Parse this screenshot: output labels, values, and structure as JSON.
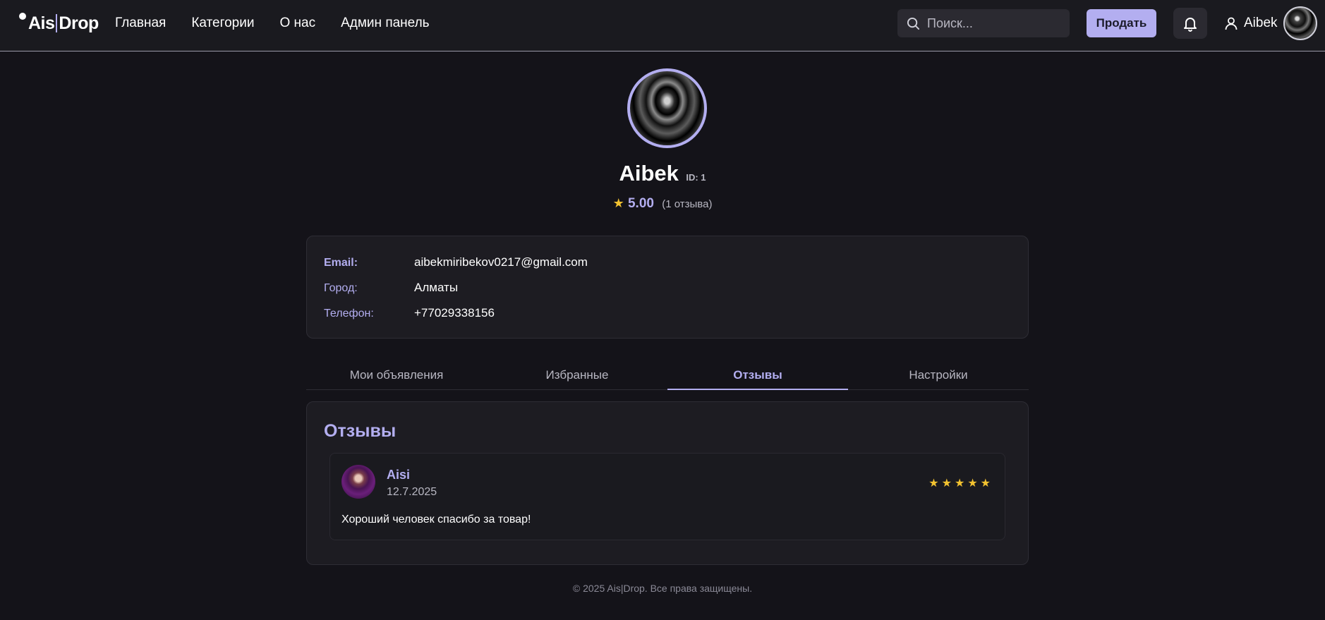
{
  "header": {
    "logo_left": "Ais",
    "logo_right": "Drop",
    "nav": [
      "Главная",
      "Категории",
      "О нас",
      "Админ панель"
    ],
    "search_placeholder": "Поиск...",
    "sell_label": "Продать",
    "username": "Aibek"
  },
  "profile": {
    "name": "Aibek",
    "id_label": "ID: 1",
    "rating_value": "5.00",
    "rating_count": "(1 отзыва)"
  },
  "info": {
    "rows": [
      {
        "label": "Email:",
        "value": "aibekmiribekov0217@gmail.com"
      },
      {
        "label": "Город:",
        "value": "Алматы"
      },
      {
        "label": "Телефон:",
        "value": "+77029338156"
      }
    ]
  },
  "tabs": [
    "Мои объявления",
    "Избранные",
    "Отзывы",
    "Настройки"
  ],
  "active_tab": 2,
  "reviews": {
    "title": "Отзывы",
    "items": [
      {
        "author": "Aisi",
        "date": "12.7.2025",
        "stars": 5,
        "text": "Хороший человек спасибо за товар!"
      }
    ]
  },
  "footer": "© 2025 Ais|Drop. Все права защищены.",
  "colors": {
    "accent": "#b3aef0",
    "star": "#f2c230",
    "background": "#141319"
  }
}
